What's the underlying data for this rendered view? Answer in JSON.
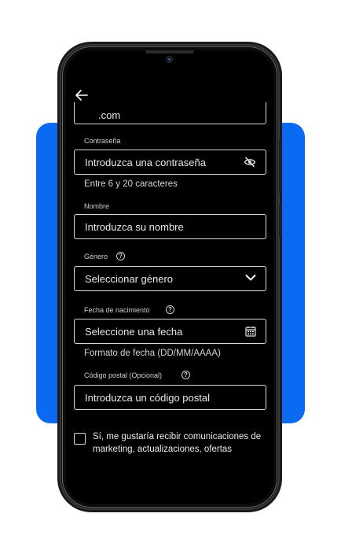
{
  "form": {
    "email_partial": ".com",
    "password": {
      "label": "Contraseña",
      "placeholder": "Introduzca una contraseña",
      "hint": "Entre 6 y 20 caracteres",
      "toggle_icon": "eye-off-icon"
    },
    "name": {
      "label": "Nombre",
      "placeholder": "Introduzca su nombre"
    },
    "gender": {
      "label": "Género",
      "value": "Seleccionar género",
      "icon": "chevron-down-icon"
    },
    "birthdate": {
      "label": "Fecha de nacimiento",
      "placeholder": "Seleccione una fecha",
      "hint": "Formato de fecha (DD/MM/AAAA)",
      "icon": "calendar-icon"
    },
    "postal": {
      "label": "Código postal (Opcional)",
      "placeholder": "Introduzca un código postal"
    },
    "consent": {
      "text": "Sí, me gustaría recibir comunicaciones de marketing, actualizaciones, ofertas",
      "checked": false
    }
  },
  "help_glyph": "?",
  "colors": {
    "accent": "#0a6af2",
    "screen": "#000000",
    "field_border": "#d9d9d9"
  }
}
